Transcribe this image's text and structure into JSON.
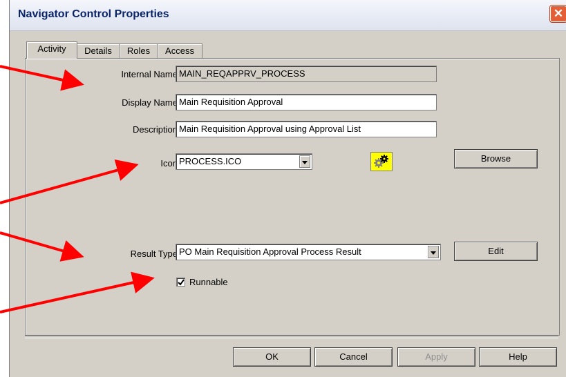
{
  "window": {
    "title": "Navigator Control Properties"
  },
  "tabs": [
    {
      "label": "Activity",
      "active": true
    },
    {
      "label": "Details"
    },
    {
      "label": "Roles"
    },
    {
      "label": "Access"
    }
  ],
  "form": {
    "internal_name": {
      "label": "Internal Name",
      "value": "MAIN_REQAPPRV_PROCESS",
      "readonly": true
    },
    "display_name": {
      "label": "Display Name",
      "value": "Main Requisition Approval"
    },
    "description": {
      "label": "Description",
      "value": "Main Requisition Approval using Approval List"
    },
    "icon": {
      "label": "Icon",
      "value": "PROCESS.ICO",
      "preview_icon": "gears-icon"
    },
    "result_type": {
      "label": "Result Type",
      "value": "PO Main Requisition Approval Process Result"
    },
    "runnable": {
      "label": "Runnable",
      "checked": true
    }
  },
  "buttons": {
    "browse": "Browse",
    "edit": "Edit",
    "ok": "OK",
    "cancel": "Cancel",
    "apply": "Apply",
    "help": "Help"
  },
  "colors": {
    "annotation_arrow": "#ff0000",
    "dialog_bg": "#d4d0c8",
    "title_text": "#0a246a",
    "icon_preview_bg": "#ffff00"
  }
}
